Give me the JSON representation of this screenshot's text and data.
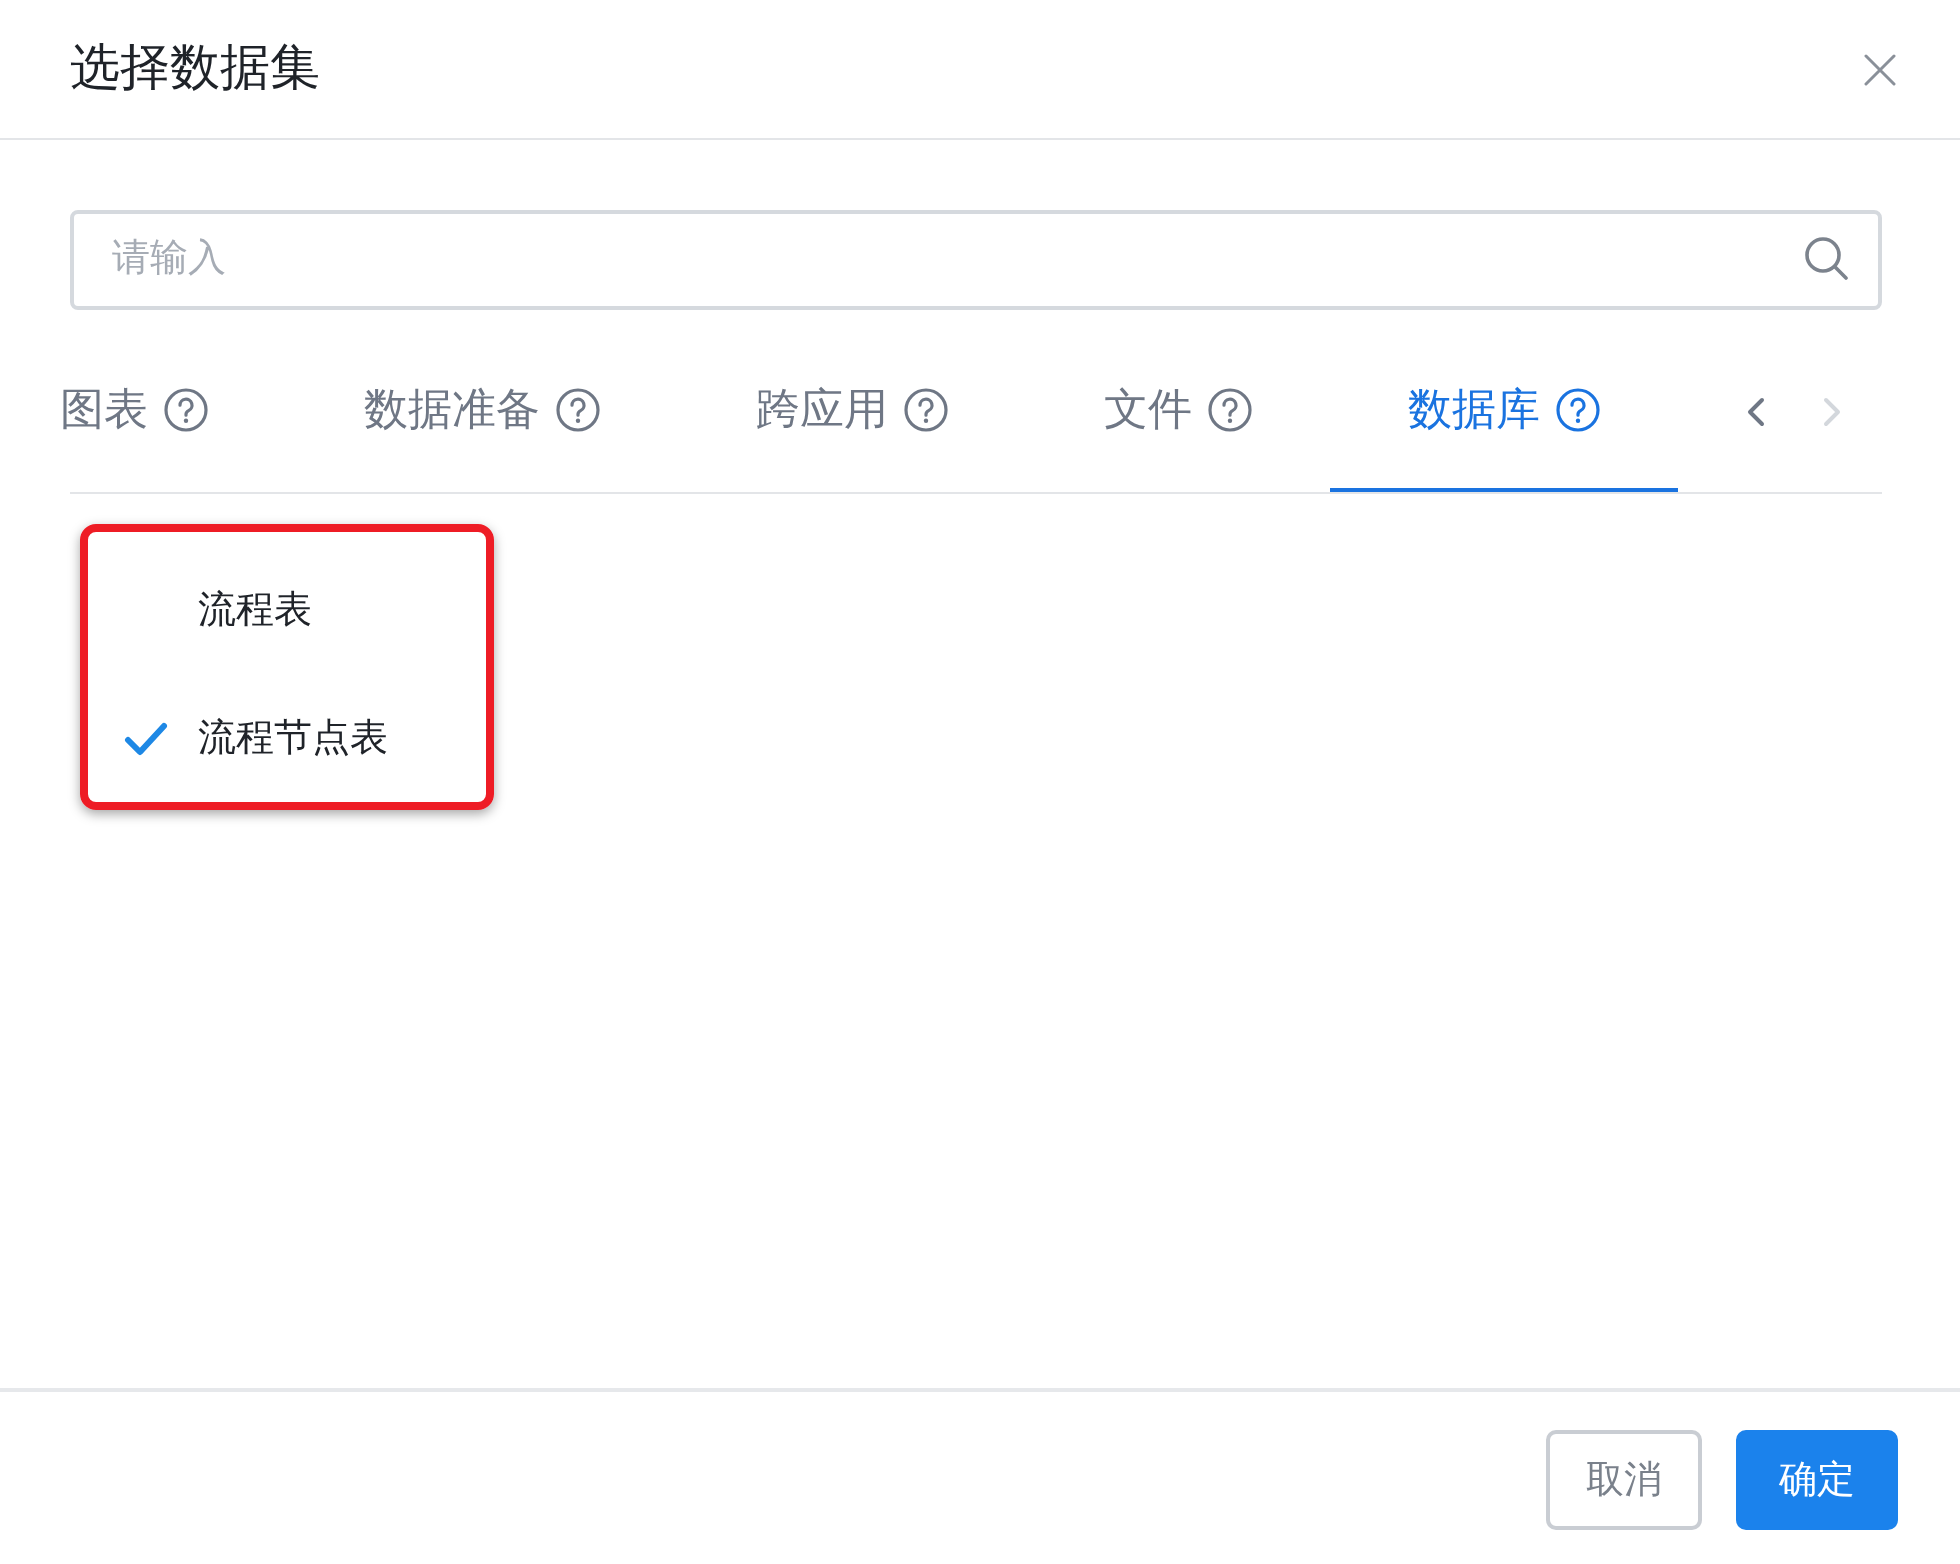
{
  "dialog": {
    "title": "选择数据集"
  },
  "search": {
    "placeholder": "请输入"
  },
  "tabs": [
    {
      "label": "图表",
      "selected": false
    },
    {
      "label": "数据准备",
      "selected": false
    },
    {
      "label": "跨应用",
      "selected": false
    },
    {
      "label": "文件",
      "selected": false
    },
    {
      "label": "数据库",
      "selected": true
    }
  ],
  "tab_scroll_buttons": [
    {
      "kind": "prev",
      "disabled": false
    },
    {
      "kind": "next",
      "disabled": true
    }
  ],
  "items": [
    {
      "label": "流程表",
      "selected": false
    },
    {
      "label": "流程节点表",
      "selected": true
    }
  ],
  "buttons": [
    {
      "label": "取消",
      "kind": "secondary"
    },
    {
      "label": "确定",
      "kind": "primary"
    }
  ]
}
